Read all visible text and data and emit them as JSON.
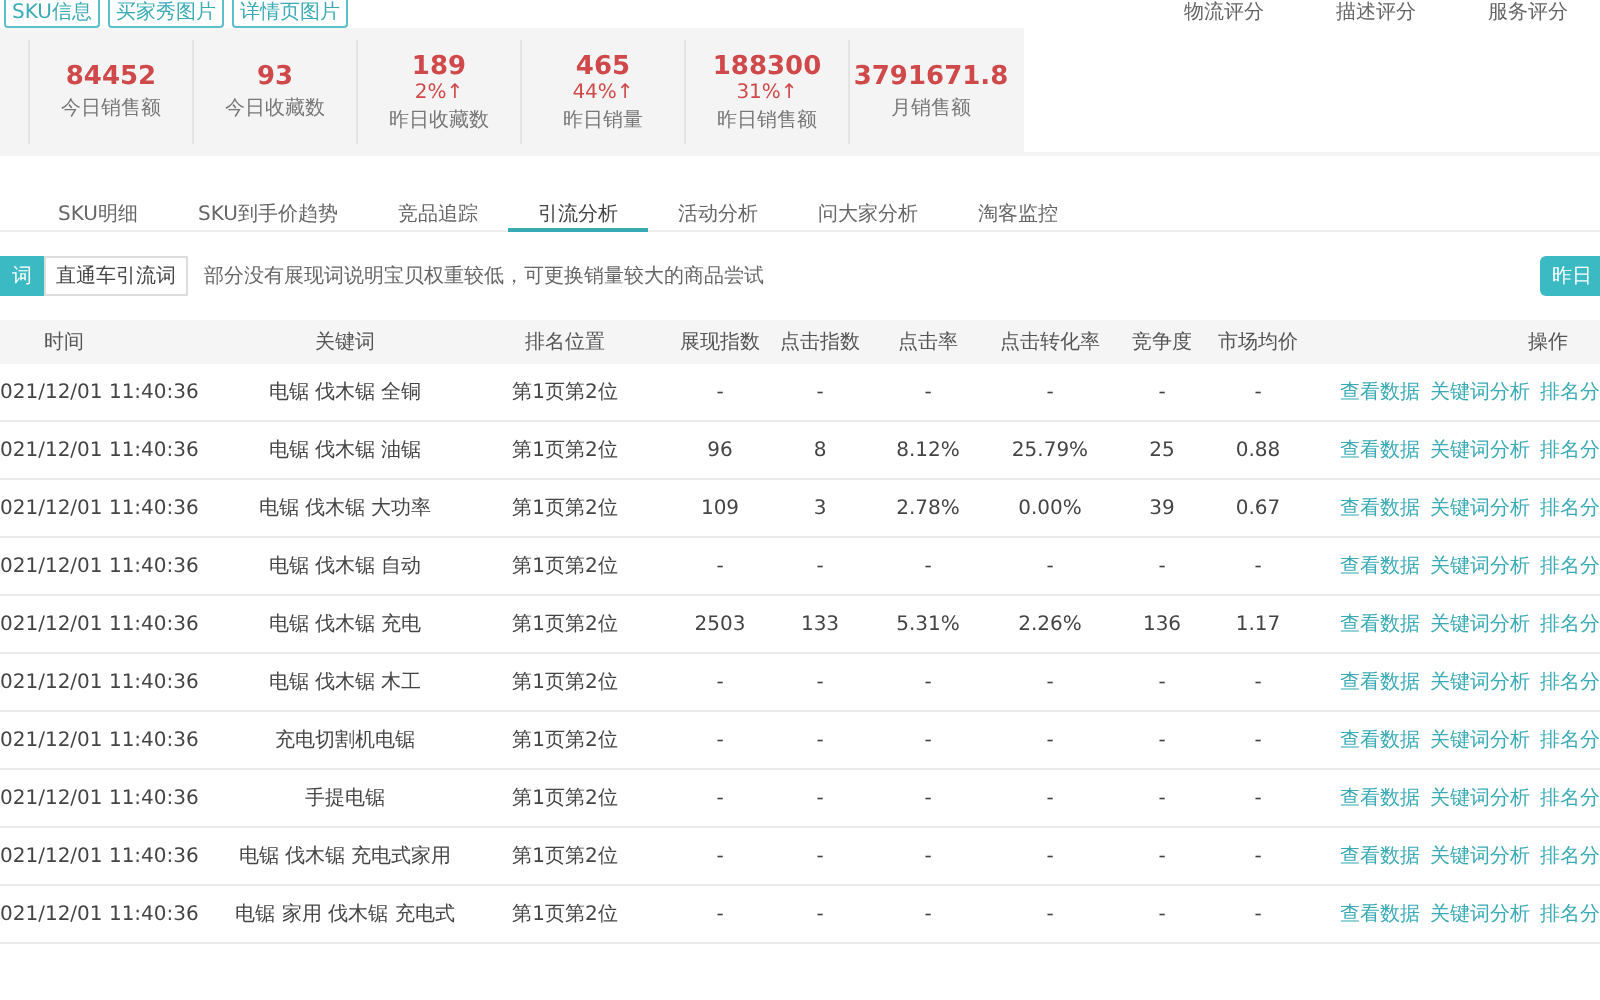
{
  "top_tags": [
    "SKU信息",
    "买家秀图片",
    "详情页图片"
  ],
  "score_headers": [
    "物流评分",
    "描述评分",
    "服务评分"
  ],
  "stats": [
    {
      "value": "84452",
      "label": "今日销售额"
    },
    {
      "value": "93",
      "label": "今日收藏数"
    },
    {
      "value": "189",
      "change": "2%↑",
      "label": "昨日收藏数"
    },
    {
      "value": "465",
      "change": "44%↑",
      "label": "昨日销量"
    },
    {
      "value": "188300",
      "change": "31%↑",
      "label": "昨日销售额"
    },
    {
      "value": "3791671.8",
      "label": "月销售额"
    }
  ],
  "tabs": [
    {
      "label": "SKU明细",
      "selected": false
    },
    {
      "label": "SKU到手价趋势",
      "selected": false
    },
    {
      "label": "竞品追踪",
      "selected": false
    },
    {
      "label": "引流分析",
      "selected": true
    },
    {
      "label": "活动分析",
      "selected": false
    },
    {
      "label": "问大家分析",
      "selected": false
    },
    {
      "label": "淘客监控",
      "selected": false
    }
  ],
  "toolbar": {
    "segments": [
      {
        "label": "词",
        "selected": true
      },
      {
        "label": "直通车引流词",
        "selected": false
      }
    ],
    "note": "部分没有展现词说明宝贝权重较低，可更换销量较大的商品尝试",
    "date_button": "昨日"
  },
  "table": {
    "columns": [
      "时间",
      "关键词",
      "排名位置",
      "展现指数",
      "点击指数",
      "点击率",
      "点击转化率",
      "竞争度",
      "市场均价",
      "操作"
    ],
    "rows": [
      {
        "cells": [
          "021/12/01 11:40:36",
          "电锯 伐木锯 全铜",
          "第1页第2位",
          "-",
          "-",
          "-",
          "-",
          "-",
          "-"
        ],
        "actions": [
          "查看数据",
          "关键词分析",
          "排名分"
        ]
      },
      {
        "cells": [
          "021/12/01 11:40:36",
          "电锯 伐木锯 油锯",
          "第1页第2位",
          "96",
          "8",
          "8.12%",
          "25.79%",
          "25",
          "0.88"
        ],
        "actions": [
          "查看数据",
          "关键词分析",
          "排名分"
        ]
      },
      {
        "cells": [
          "021/12/01 11:40:36",
          "电锯 伐木锯 大功率",
          "第1页第2位",
          "109",
          "3",
          "2.78%",
          "0.00%",
          "39",
          "0.67"
        ],
        "actions": [
          "查看数据",
          "关键词分析",
          "排名分"
        ]
      },
      {
        "cells": [
          "021/12/01 11:40:36",
          "电锯 伐木锯 自动",
          "第1页第2位",
          "-",
          "-",
          "-",
          "-",
          "-",
          "-"
        ],
        "actions": [
          "查看数据",
          "关键词分析",
          "排名分"
        ]
      },
      {
        "cells": [
          "021/12/01 11:40:36",
          "电锯 伐木锯 充电",
          "第1页第2位",
          "2503",
          "133",
          "5.31%",
          "2.26%",
          "136",
          "1.17"
        ],
        "actions": [
          "查看数据",
          "关键词分析",
          "排名分"
        ]
      },
      {
        "cells": [
          "021/12/01 11:40:36",
          "电锯 伐木锯 木工",
          "第1页第2位",
          "-",
          "-",
          "-",
          "-",
          "-",
          "-"
        ],
        "actions": [
          "查看数据",
          "关键词分析",
          "排名分"
        ]
      },
      {
        "cells": [
          "021/12/01 11:40:36",
          "充电切割机电锯",
          "第1页第2位",
          "-",
          "-",
          "-",
          "-",
          "-",
          "-"
        ],
        "actions": [
          "查看数据",
          "关键词分析",
          "排名分"
        ]
      },
      {
        "cells": [
          "021/12/01 11:40:36",
          "手提电锯",
          "第1页第2位",
          "-",
          "-",
          "-",
          "-",
          "-",
          "-"
        ],
        "actions": [
          "查看数据",
          "关键词分析",
          "排名分"
        ]
      },
      {
        "cells": [
          "021/12/01 11:40:36",
          "电锯 伐木锯 充电式家用",
          "第1页第2位",
          "-",
          "-",
          "-",
          "-",
          "-",
          "-"
        ],
        "actions": [
          "查看数据",
          "关键词分析",
          "排名分"
        ]
      },
      {
        "cells": [
          "021/12/01 11:40:36",
          "电锯 家用 伐木锯 充电式",
          "第1页第2位",
          "-",
          "-",
          "-",
          "-",
          "-",
          "-"
        ],
        "actions": [
          "查看数据",
          "关键词分析",
          "排名分"
        ]
      }
    ]
  }
}
